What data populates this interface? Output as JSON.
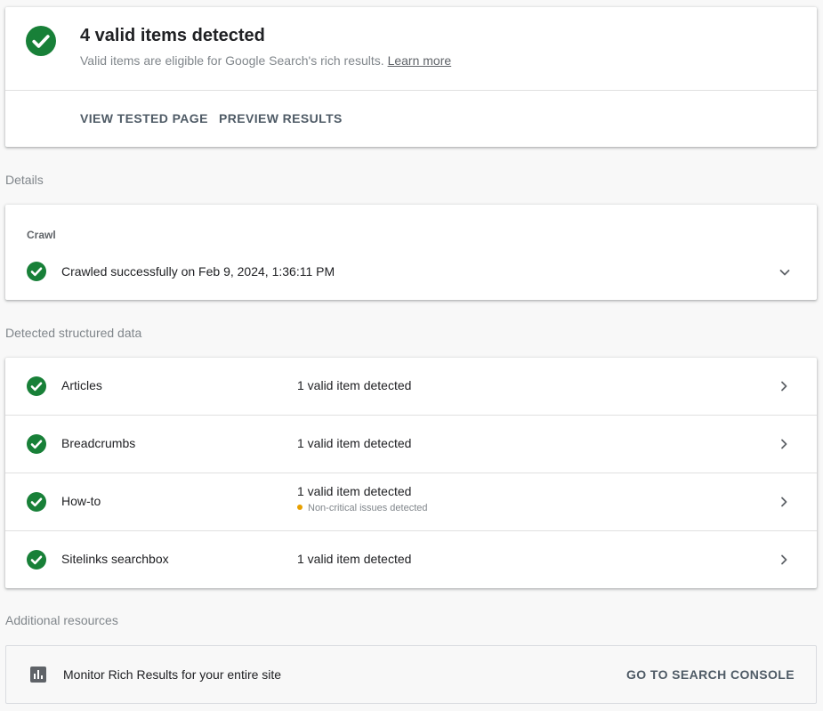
{
  "summary": {
    "title": "4 valid items detected",
    "subtitle": "Valid items are eligible for Google Search's rich results.",
    "learn_more": "Learn more",
    "actions": [
      "VIEW TESTED PAGE",
      "PREVIEW RESULTS"
    ]
  },
  "details_label": "Details",
  "crawl": {
    "kicker": "Crawl",
    "status": "Crawled successfully on Feb 9, 2024, 1:36:11 PM"
  },
  "structured_label": "Detected structured data",
  "structured": [
    {
      "name": "Articles",
      "status": "1 valid item detected",
      "warning": ""
    },
    {
      "name": "Breadcrumbs",
      "status": "1 valid item detected",
      "warning": ""
    },
    {
      "name": "How-to",
      "status": "1 valid item detected",
      "warning": "Non-critical issues detected"
    },
    {
      "name": "Sitelinks searchbox",
      "status": "1 valid item detected",
      "warning": ""
    }
  ],
  "resources_label": "Additional resources",
  "resources": {
    "text": "Monitor Rich Results for your entire site",
    "cta": "GO TO SEARCH CONSOLE"
  },
  "colors": {
    "success": "#188038",
    "warning": "#e8a000",
    "action_text": "#4f5b66"
  },
  "icons": [
    "check-circle-icon",
    "chevron-down-icon",
    "chevron-right-icon",
    "bar-chart-icon"
  ]
}
